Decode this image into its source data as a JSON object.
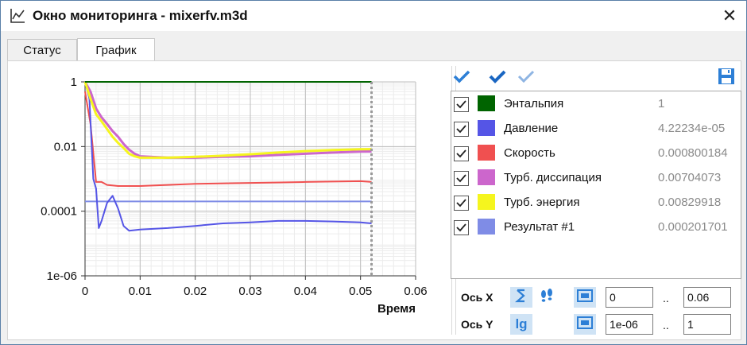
{
  "window": {
    "title": "Окно мониторинга - mixerfv.m3d",
    "icon": "chart-line-icon"
  },
  "tabs": [
    {
      "label": "Статус",
      "active": false
    },
    {
      "label": "График",
      "active": true
    }
  ],
  "toolbar": {
    "icons": [
      "check-icon",
      "check-all-icon",
      "uncheck-icon",
      "save-icon"
    ]
  },
  "legend": {
    "items": [
      {
        "name": "Энтальпия",
        "value": "1",
        "color": "#006400",
        "checked": true
      },
      {
        "name": "Давление",
        "value": "4.22234e-05",
        "color": "#5555e6",
        "checked": true
      },
      {
        "name": "Скорость",
        "value": "0.000800184",
        "color": "#f05050",
        "checked": true
      },
      {
        "name": "Турб. диссипация",
        "value": "0.00704073",
        "color": "#cc66cc",
        "checked": true
      },
      {
        "name": "Турб. энергия",
        "value": "0.00829918",
        "color": "#f5f51e",
        "checked": true
      },
      {
        "name": "Результат #1",
        "value": "0.000201701",
        "color": "#7f8ce6",
        "checked": true
      }
    ]
  },
  "axis_controls": {
    "x": {
      "label": "Ось X",
      "min": "0",
      "max": "0.06",
      "sep": ".."
    },
    "y": {
      "label": "Ось Y",
      "min": "1e-06",
      "max": "1",
      "sep": "..",
      "log_button": "lg"
    }
  },
  "chart_data": {
    "type": "line",
    "title": "",
    "xlabel": "Время",
    "ylabel": "",
    "xlim": [
      0,
      0.06
    ],
    "ylim": [
      1e-06,
      1
    ],
    "yscale": "log",
    "x_ticks": [
      "0",
      "0.01",
      "0.02",
      "0.03",
      "0.04",
      "0.05",
      "0.06"
    ],
    "y_ticks": [
      "1",
      "0.01",
      "0.0001",
      "1e-06"
    ],
    "grid": true,
    "current_time": 0.052,
    "series": [
      {
        "name": "Энтальпия",
        "color": "#006400",
        "x": [
          0,
          0.001,
          0.01,
          0.02,
          0.03,
          0.04,
          0.052
        ],
        "y": [
          1,
          1,
          1,
          1,
          1,
          1,
          1
        ]
      },
      {
        "name": "Давление",
        "color": "#5555e6",
        "x": [
          0,
          0.0008,
          0.0015,
          0.002,
          0.0025,
          0.003,
          0.004,
          0.005,
          0.006,
          0.007,
          0.008,
          0.01,
          0.015,
          0.02,
          0.025,
          0.03,
          0.035,
          0.04,
          0.045,
          0.05,
          0.052
        ],
        "y": [
          1,
          0.3,
          0.001,
          0.0005,
          3e-05,
          5e-05,
          0.00018,
          0.0003,
          0.00012,
          3.5e-05,
          2.5e-05,
          2.7e-05,
          3e-05,
          3.5e-05,
          4.2e-05,
          4.5e-05,
          5e-05,
          5e-05,
          4.8e-05,
          4.5e-05,
          4.2e-05
        ]
      },
      {
        "name": "Скорость",
        "color": "#f05050",
        "x": [
          0,
          0.001,
          0.002,
          0.003,
          0.004,
          0.006,
          0.01,
          0.02,
          0.03,
          0.04,
          0.05,
          0.052
        ],
        "y": [
          0.5,
          0.05,
          0.0008,
          0.0008,
          0.00065,
          0.0006,
          0.0006,
          0.0007,
          0.00075,
          0.0008,
          0.00085,
          0.0008
        ]
      },
      {
        "name": "Турб. диссипация",
        "color": "#cc66cc",
        "x": [
          0,
          0.001,
          0.002,
          0.003,
          0.004,
          0.005,
          0.006,
          0.007,
          0.008,
          0.009,
          0.01,
          0.015,
          0.02,
          0.025,
          0.03,
          0.035,
          0.04,
          0.045,
          0.05,
          0.052
        ],
        "y": [
          1,
          0.5,
          0.15,
          0.08,
          0.05,
          0.03,
          0.02,
          0.012,
          0.008,
          0.006,
          0.005,
          0.0045,
          0.0045,
          0.0048,
          0.005,
          0.0055,
          0.006,
          0.0065,
          0.007,
          0.00704
        ]
      },
      {
        "name": "Турб. энергия",
        "color": "#f5f51e",
        "x": [
          0,
          0.001,
          0.002,
          0.003,
          0.004,
          0.005,
          0.006,
          0.007,
          0.008,
          0.009,
          0.01,
          0.015,
          0.02,
          0.025,
          0.03,
          0.035,
          0.04,
          0.045,
          0.05,
          0.052
        ],
        "y": [
          1,
          0.3,
          0.1,
          0.06,
          0.035,
          0.02,
          0.013,
          0.009,
          0.006,
          0.005,
          0.0045,
          0.0045,
          0.0048,
          0.0052,
          0.0058,
          0.0065,
          0.0072,
          0.0078,
          0.0082,
          0.0083
        ]
      },
      {
        "name": "Результат #1",
        "color": "#7f8ce6",
        "x": [
          0,
          0.052
        ],
        "y": [
          0.0002,
          0.0002
        ]
      }
    ]
  }
}
